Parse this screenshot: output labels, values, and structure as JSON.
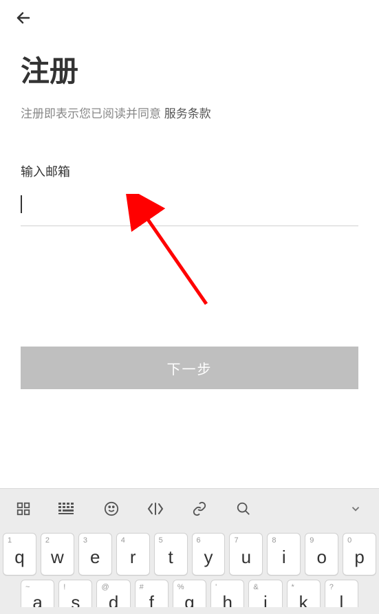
{
  "header": {
    "back_icon": "back-arrow"
  },
  "page": {
    "title": "注册",
    "consent_prefix": "注册即表示您已阅读并同意 ",
    "consent_link": "服务条款",
    "field_label": "输入邮箱",
    "input_value": "",
    "next_button": "下一步"
  },
  "keyboard": {
    "toolbar": [
      "grid",
      "keyboard",
      "emoji",
      "code",
      "link",
      "search",
      "chevron"
    ],
    "row1": [
      {
        "sub": "1",
        "main": "q"
      },
      {
        "sub": "2",
        "main": "w"
      },
      {
        "sub": "3",
        "main": "e"
      },
      {
        "sub": "4",
        "main": "r"
      },
      {
        "sub": "5",
        "main": "t"
      },
      {
        "sub": "6",
        "main": "y"
      },
      {
        "sub": "7",
        "main": "u"
      },
      {
        "sub": "8",
        "main": "i"
      },
      {
        "sub": "9",
        "main": "o"
      },
      {
        "sub": "0",
        "main": "p"
      }
    ],
    "row2": [
      {
        "sub": "~",
        "main": "a"
      },
      {
        "sub": "!",
        "main": "s"
      },
      {
        "sub": "@",
        "main": "d"
      },
      {
        "sub": "#",
        "main": "f"
      },
      {
        "sub": "%",
        "main": "g"
      },
      {
        "sub": "'",
        "main": "h"
      },
      {
        "sub": "&",
        "main": "j"
      },
      {
        "sub": "*",
        "main": "k"
      },
      {
        "sub": "?",
        "main": "l"
      }
    ]
  }
}
